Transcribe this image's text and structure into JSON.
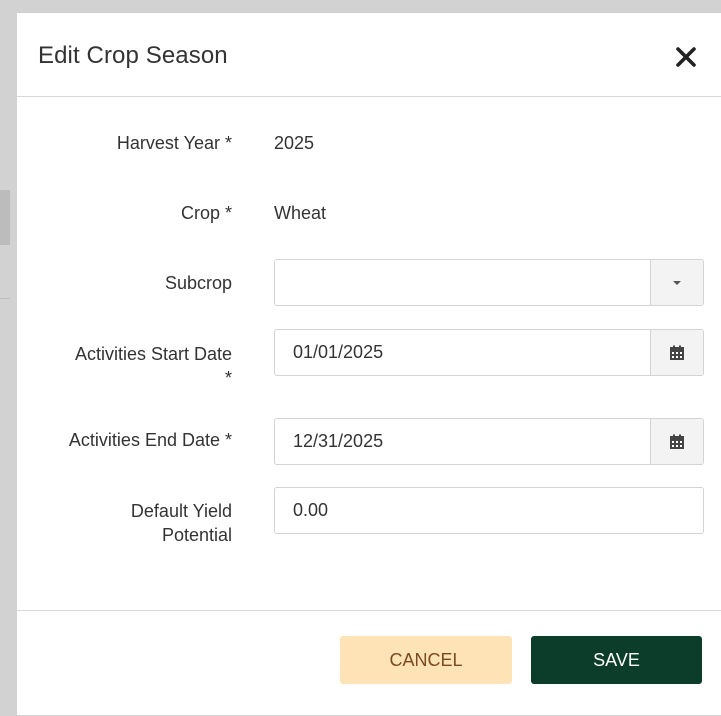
{
  "dialog": {
    "title": "Edit Crop Season",
    "close_icon": "close-icon"
  },
  "form": {
    "harvest_year": {
      "label": "Harvest Year *",
      "value": "2025"
    },
    "crop": {
      "label": "Crop *",
      "value": "Wheat"
    },
    "subcrop": {
      "label": "Subcrop",
      "value": "",
      "icon": "caret-down-icon"
    },
    "start_date": {
      "label_line1": "Activities Start Date",
      "label_line2": "*",
      "value": "01/01/2025",
      "icon": "calendar-icon"
    },
    "end_date": {
      "label": "Activities End Date *",
      "value": "12/31/2025",
      "icon": "calendar-icon"
    },
    "default_yield": {
      "label_line1": "Default Yield",
      "label_line2": "Potential",
      "value": "0.00"
    }
  },
  "footer": {
    "cancel_label": "CANCEL",
    "save_label": "SAVE"
  },
  "colors": {
    "cancel_bg": "#fde3b5",
    "cancel_text": "#7a4a22",
    "save_bg": "#0c3c2a",
    "save_text": "#ffffff"
  }
}
